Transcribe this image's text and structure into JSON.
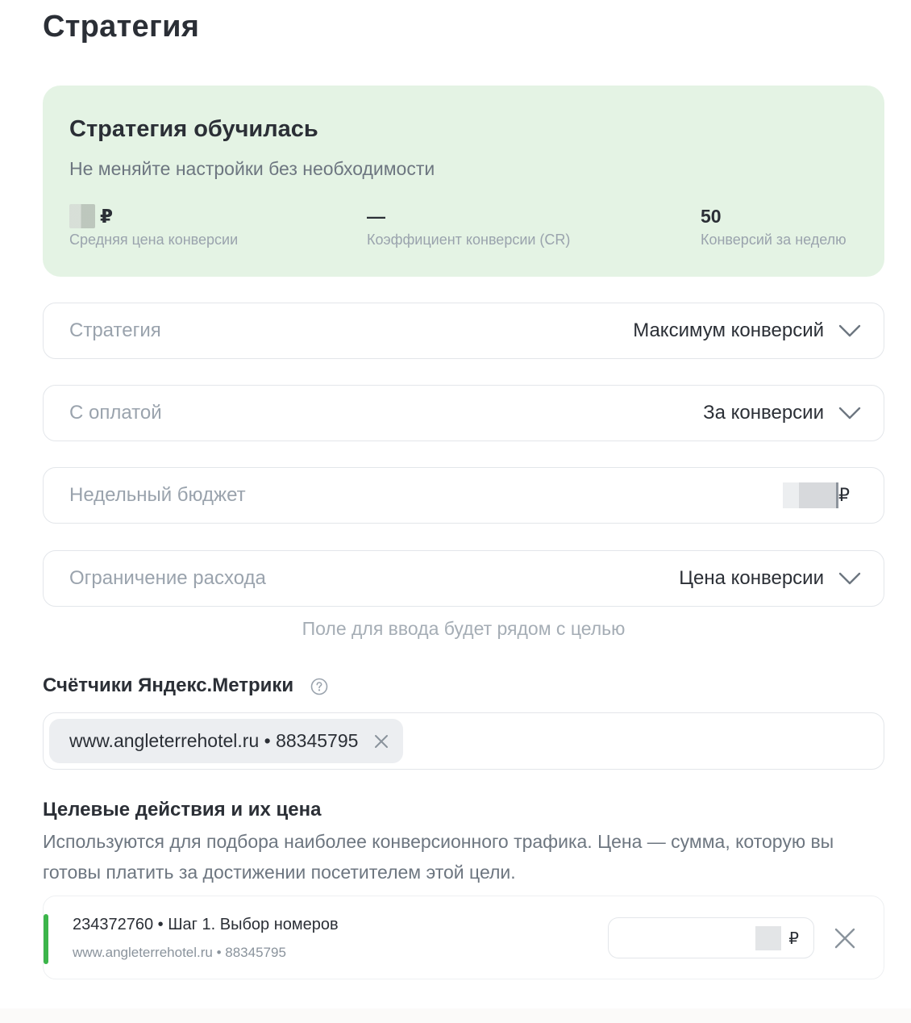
{
  "page": {
    "title": "Стратегия"
  },
  "status": {
    "title": "Стратегия обучилась",
    "subtitle": "Не меняйте настройки без необходимости",
    "metrics": [
      {
        "value": "₽",
        "label": "Средняя цена конверсии"
      },
      {
        "value": "—",
        "label": "Коэффициент конверсии (CR)"
      },
      {
        "value": "50",
        "label": "Конверсий за неделю"
      }
    ]
  },
  "fields": {
    "strategy": {
      "label": "Стратегия",
      "value": "Максимум конверсий"
    },
    "payment": {
      "label": "С оплатой",
      "value": "За конверсии"
    },
    "budget": {
      "label": "Недельный бюджет",
      "currency": "₽"
    },
    "limit": {
      "label": "Ограничение расхода",
      "value": "Цена конверсии"
    }
  },
  "hint": "Поле для ввода будет рядом с целью",
  "counters": {
    "title": "Счётчики Яндекс.Метрики",
    "chip": "www.angleterrehotel.ru • 88345795"
  },
  "goals": {
    "title": "Целевые действия и их цена",
    "description": "Используются для подбора наиболее конверсионного трафика. Цена — сумма, которую вы готовы платить за достижении посетителем этой цели.",
    "items": [
      {
        "title": "234372760 • Шаг 1. Выбор номеров",
        "subtitle": "www.angleterrehotel.ru • 88345795",
        "currency": "₽"
      }
    ]
  },
  "colors": {
    "success_bg": "#e4f3e4",
    "accent_green": "#3cb54a"
  }
}
